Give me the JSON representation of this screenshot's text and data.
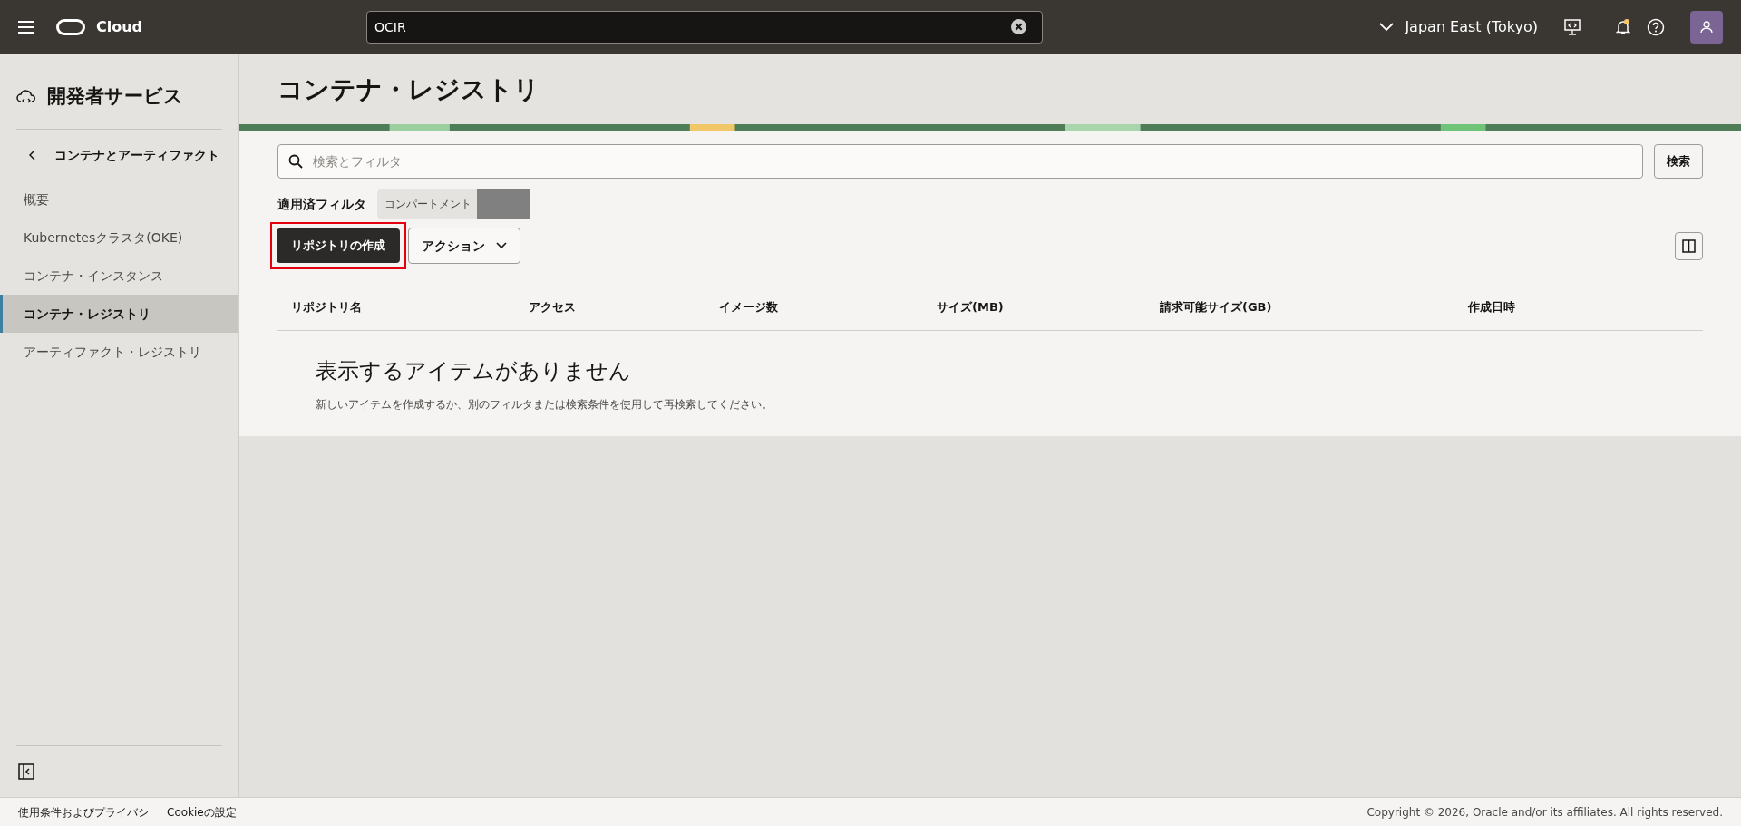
{
  "header": {
    "brand": "Cloud",
    "search_value": "OCIR",
    "region": "Japan East (Tokyo)",
    "notification_dot": true
  },
  "sidebar": {
    "title": "開発者サービス",
    "back_label": "コンテナとアーティファクト",
    "items": [
      {
        "label": "概要",
        "selected": false
      },
      {
        "label": "Kubernetesクラスタ(OKE)",
        "selected": false
      },
      {
        "label": "コンテナ・インスタンス",
        "selected": false
      },
      {
        "label": "コンテナ・レジストリ",
        "selected": true
      },
      {
        "label": "アーティファクト・レジストリ",
        "selected": false
      }
    ]
  },
  "page": {
    "title": "コンテナ・レジストリ",
    "search_placeholder": "検索とフィルタ",
    "search_button": "検索",
    "applied_filters_label": "適用済フィルタ",
    "filter_chip": "コンパートメント",
    "filter_value_redacted": true,
    "create_button": "リポジトリの作成",
    "create_button_highlighted": true,
    "actions_button": "アクション",
    "table": {
      "columns": [
        "リポジトリ名",
        "アクセス",
        "イメージ数",
        "サイズ(MB)",
        "請求可能サイズ(GB)",
        "作成日時"
      ],
      "empty_title": "表示するアイテムがありません",
      "empty_message": "新しいアイテムを作成するか、別のフィルタまたは検索条件を使用して再検索してください。"
    }
  },
  "footer": {
    "links": [
      "使用条件およびプライバシ",
      "Cookieの設定"
    ],
    "copyright": "Copyright © 2026, Oracle and/or its affiliates. All rights reserved."
  }
}
